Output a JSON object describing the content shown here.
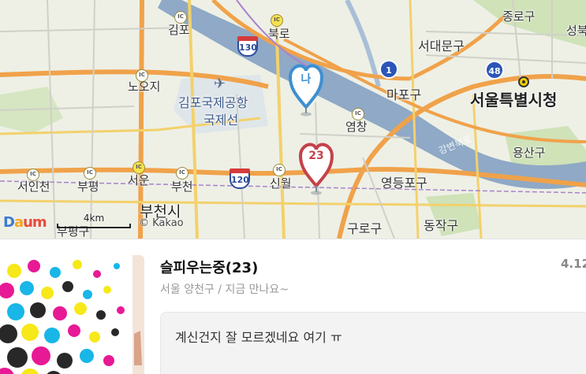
{
  "map": {
    "labels": {
      "jongno": "종로구",
      "seongbuk": "성북",
      "seodaemun": "서대문구",
      "city_hall": "서울특별시청",
      "mapo": "마포구",
      "yongsan": "용산구",
      "yeongdeungpo": "영등포구",
      "dongjak": "동작구",
      "guro": "구로구",
      "gimpo": "김포",
      "bukro": "북로",
      "nohji": "노오지",
      "gimpo_airport": "김포국제공항",
      "gukjeseon": "국제선",
      "yeomchang": "염창",
      "seoin": "서인천",
      "bupyeong": "부평",
      "seoun": "서운",
      "bucheon_ic": "부천",
      "sinwol": "신월",
      "bucheon_si": "부천시",
      "bupyeonggu": "부평구",
      "river": "강변북로"
    },
    "route_shields": {
      "r130": "130",
      "r120": "120",
      "r1": "1",
      "r48": "48"
    },
    "ic_text": "IC",
    "pins": {
      "me_label": "나",
      "other_label": "23",
      "me_color": "#3d8fd1",
      "other_color": "#c4424a"
    },
    "scale": "4km",
    "brand": {
      "d1": "D",
      "d2": "a",
      "d3": "um"
    },
    "copyright": "© Kakao"
  },
  "profile": {
    "name": "슬피우는중(23)",
    "location_status": "서울 양천구 / 지금 만나요~",
    "rating": "4.12",
    "message": "계신건지 잘 모르겠네요 여기 ㅠ"
  }
}
